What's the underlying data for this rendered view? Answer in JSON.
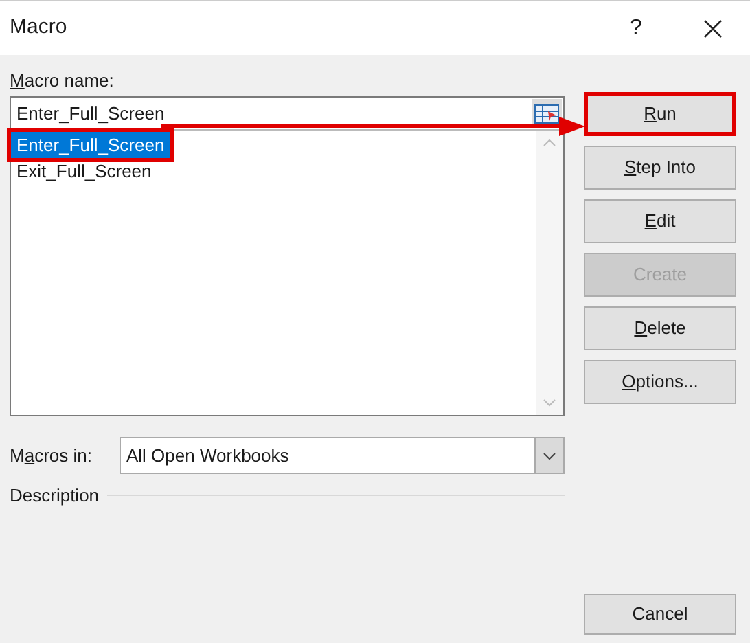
{
  "window": {
    "title": "Macro",
    "help": "?"
  },
  "macro_name": {
    "label": {
      "key": "M",
      "rest": "acro name:"
    },
    "value": "Enter_Full_Screen"
  },
  "macros": [
    {
      "name": "Enter_Full_Screen",
      "selected": true,
      "highlighted": true
    },
    {
      "name": "Exit_Full_Screen",
      "selected": false,
      "highlighted": false
    }
  ],
  "macros_in": {
    "label": {
      "lead": "M",
      "key": "a",
      "rest": "cros in:"
    },
    "value": "All Open Workbooks"
  },
  "description": {
    "label": "Description"
  },
  "buttons": [
    {
      "label": {
        "key": "R",
        "rest": "un"
      },
      "disabled": false,
      "highlighted": true
    },
    {
      "label": {
        "key": "S",
        "rest": "tep Into"
      },
      "disabled": false,
      "highlighted": false
    },
    {
      "label": {
        "key": "E",
        "rest": "dit"
      },
      "disabled": false,
      "highlighted": false
    },
    {
      "label": {
        "rest": "Create"
      },
      "disabled": true,
      "highlighted": false
    },
    {
      "label": {
        "key": "D",
        "rest": "elete"
      },
      "disabled": false,
      "highlighted": false
    },
    {
      "label": {
        "key": "O",
        "rest": "ptions..."
      },
      "disabled": false,
      "highlighted": false
    }
  ],
  "cancel": {
    "label": "Cancel"
  },
  "annotation": {
    "arrow": true
  }
}
